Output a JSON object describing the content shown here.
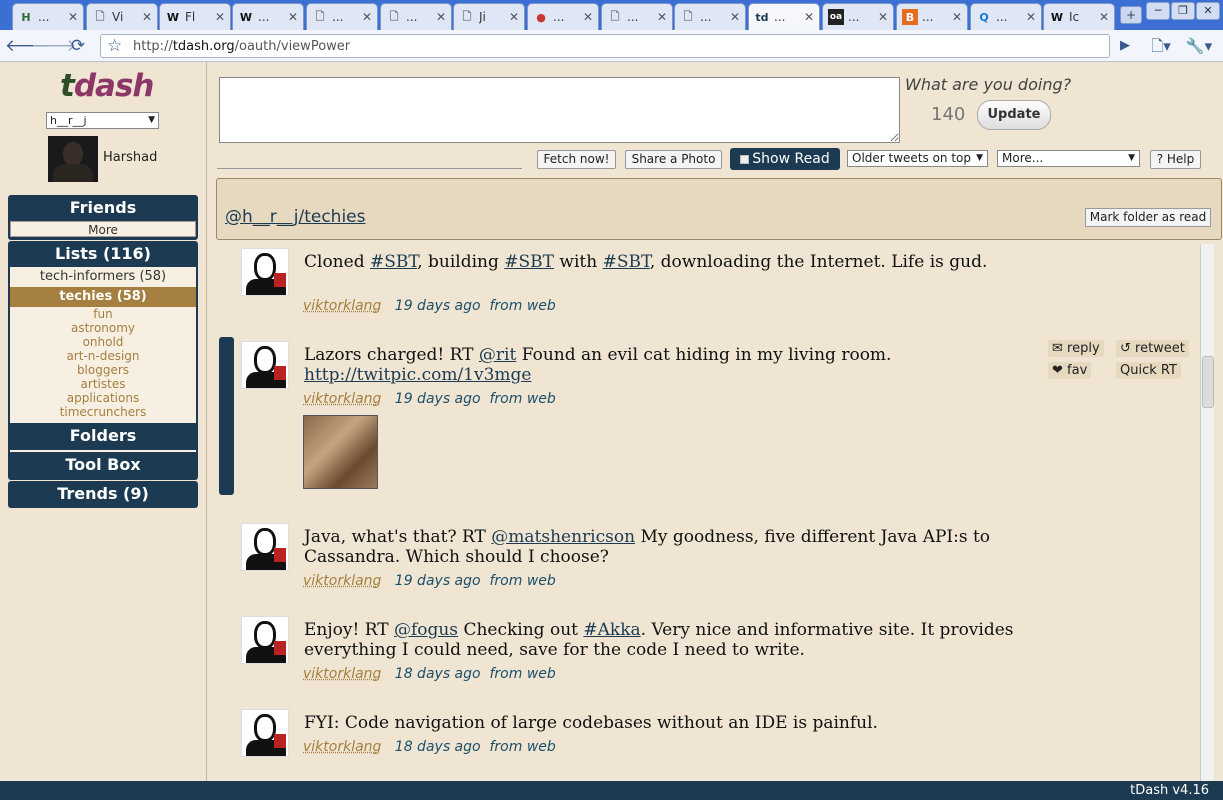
{
  "browser": {
    "tabs": [
      {
        "icon": "H",
        "title": "..."
      },
      {
        "icon": "doc",
        "title": "Vi"
      },
      {
        "icon": "W",
        "title": "Fl"
      },
      {
        "icon": "W",
        "title": "..."
      },
      {
        "icon": "doc",
        "title": "..."
      },
      {
        "icon": "doc",
        "title": "..."
      },
      {
        "icon": "doc",
        "title": "Ji"
      },
      {
        "icon": "circle",
        "title": "..."
      },
      {
        "icon": "doc",
        "title": "..."
      },
      {
        "icon": "doc",
        "title": "..."
      },
      {
        "icon": "td",
        "title": "..."
      },
      {
        "icon": "oa",
        "title": "..."
      },
      {
        "icon": "B",
        "title": "..."
      },
      {
        "icon": "Q",
        "title": "..."
      },
      {
        "icon": "W",
        "title": "Ic"
      }
    ],
    "url_prefix": "http://",
    "url_host": "tdash.org",
    "url_path": "/oauth/viewPower"
  },
  "sidebar": {
    "logo_t": "t",
    "logo_rest": "dash",
    "account": "h__r__j",
    "username": "Harshad",
    "friends": {
      "title": "Friends",
      "more": "More"
    },
    "lists": {
      "title": "Lists (116)",
      "items": [
        {
          "label": "tech-informers (58)",
          "selected": false
        },
        {
          "label": "techies (58)",
          "selected": true
        }
      ],
      "subitems": [
        "fun",
        "astronomy",
        "onhold",
        "art-n-design",
        "bloggers",
        "artistes",
        "applications",
        "timecrunchers"
      ]
    },
    "folders": "Folders",
    "toolbox": "Tool Box",
    "trends": "Trends (9)"
  },
  "composer": {
    "prompt": "What are you doing?",
    "count": "140",
    "update": "Update"
  },
  "actions": {
    "fetch": "Fetch now!",
    "share": "Share a Photo",
    "show_read": "Show Read",
    "order": "Older tweets on top",
    "more": "More...",
    "help": "? Help"
  },
  "folder": {
    "name": "@h__r__j/techies",
    "mark_read": "Mark folder as read"
  },
  "tweet_actions": {
    "reply": "✉ reply",
    "retweet": "↺ retweet",
    "fav": "❤ fav",
    "quick_rt": "Quick RT"
  },
  "tweets": [
    {
      "parts": [
        [
          "Cloned ",
          ""
        ],
        [
          "#SBT",
          "link"
        ],
        [
          ", building ",
          ""
        ],
        [
          "#SBT",
          "link"
        ],
        [
          " with ",
          ""
        ],
        [
          "#SBT",
          "link"
        ],
        [
          ", downloading the Internet. Life is gud.",
          ""
        ]
      ],
      "user": "viktorklang",
      "time": "19 days ago",
      "from": "from web"
    },
    {
      "parts": [
        [
          "Lazors charged! RT ",
          ""
        ],
        [
          "@rit",
          "link"
        ],
        [
          " Found an evil cat hiding in my living room. ",
          ""
        ],
        [
          "http://twitpic.com/1v3mge",
          "link"
        ]
      ],
      "user": "viktorklang",
      "time": "19 days ago",
      "from": "from web"
    },
    {
      "parts": [
        [
          "Java, what's that? RT ",
          ""
        ],
        [
          "@matshenricson",
          "link"
        ],
        [
          " My goodness, five different Java API:s to Cassandra. Which should I choose?",
          ""
        ]
      ],
      "user": "viktorklang",
      "time": "19 days ago",
      "from": "from web"
    },
    {
      "parts": [
        [
          "Enjoy! RT ",
          ""
        ],
        [
          "@fogus",
          "link"
        ],
        [
          " Checking out ",
          ""
        ],
        [
          "#Akka",
          "link"
        ],
        [
          ". Very nice and informative site. It provides everything I could need, save for the code I need to write.",
          ""
        ]
      ],
      "user": "viktorklang",
      "time": "18 days ago",
      "from": "from web"
    },
    {
      "parts": [
        [
          "FYI: Code navigation of large codebases without an IDE is painful.",
          ""
        ]
      ],
      "user": "viktorklang",
      "time": "18 days ago",
      "from": "from web"
    }
  ],
  "footer": "tDash v4.16"
}
